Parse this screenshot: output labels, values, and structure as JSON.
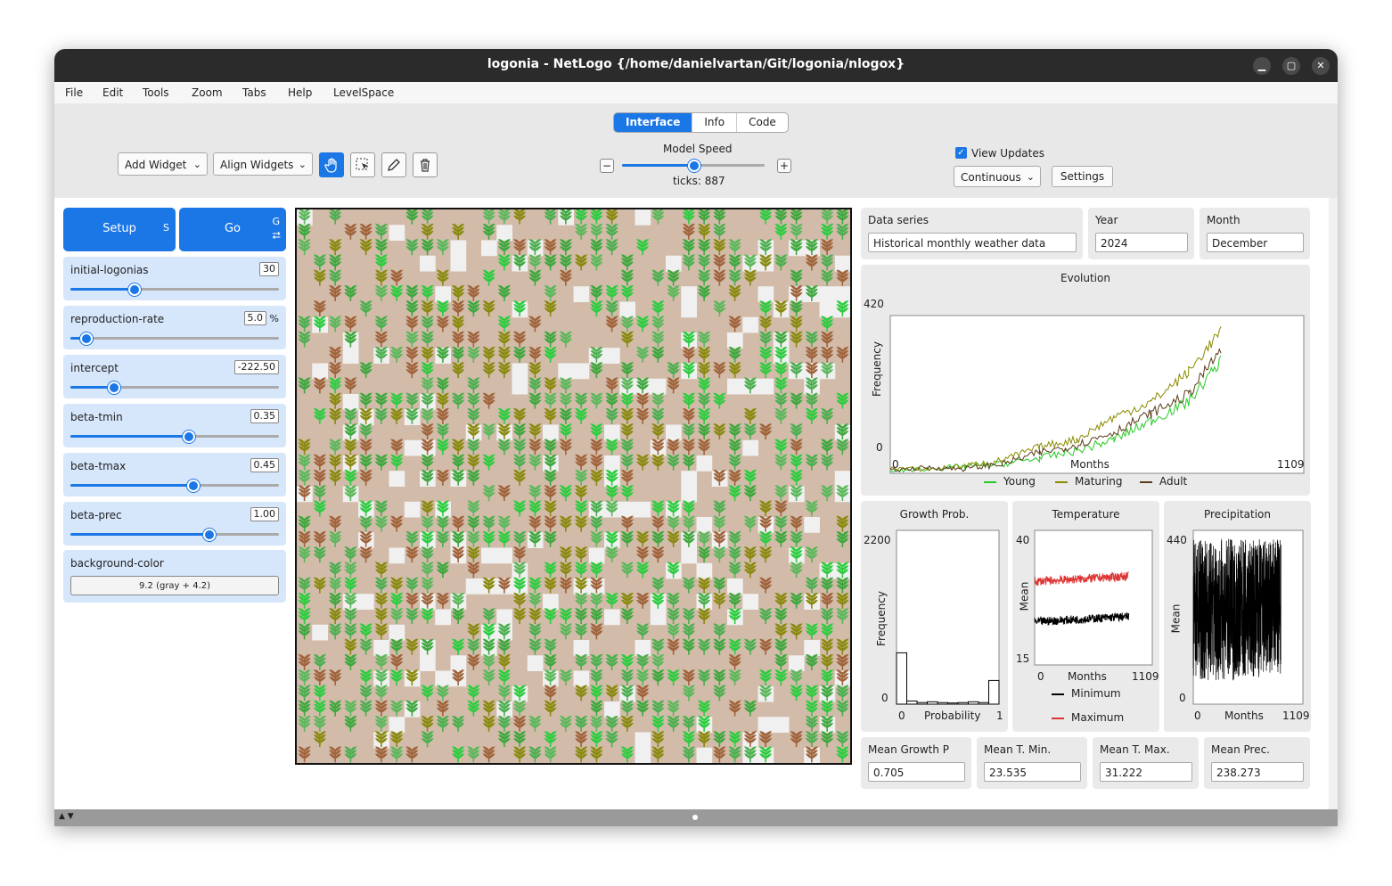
{
  "window": {
    "title": "logonia - NetLogo {/home/danielvartan/Git/logonia/nlogox}"
  },
  "menu": [
    "File",
    "Edit",
    "Tools",
    "Zoom",
    "Tabs",
    "Help",
    "LevelSpace"
  ],
  "tabs": [
    "Interface",
    "Info",
    "Code"
  ],
  "toolbar": {
    "add_widget": "Add Widget",
    "align_widgets": "Align Widgets",
    "model_speed": "Model Speed",
    "ticks": "ticks: 887",
    "minus": "−",
    "plus": "+",
    "speed_level": 0.5,
    "view_updates": "View Updates",
    "update_mode": "Continuous",
    "settings": "Settings"
  },
  "buttons": {
    "setup": "Setup",
    "setup_key": "S",
    "go": "Go",
    "go_key": "G"
  },
  "sliders": [
    {
      "name": "initial-logonias",
      "value": "30",
      "unit": "",
      "level": 0.3
    },
    {
      "name": "reproduction-rate",
      "value": "5.0",
      "unit": "%",
      "level": 0.07
    },
    {
      "name": "intercept",
      "value": "-222.50",
      "unit": "",
      "level": 0.2
    },
    {
      "name": "beta-tmin",
      "value": "0.35",
      "unit": "",
      "level": 0.56
    },
    {
      "name": "beta-tmax",
      "value": "0.45",
      "unit": "",
      "level": 0.58
    },
    {
      "name": "beta-prec",
      "value": "1.00",
      "unit": "",
      "level": 0.66
    }
  ],
  "chooser": {
    "name": "background-color",
    "value": "9.2 (gray + 4.2)"
  },
  "inputs": {
    "data_series_label": "Data series",
    "data_series_value": "Historical monthly weather data",
    "year_label": "Year",
    "year_value": "2024",
    "month_label": "Month",
    "month_value": "December"
  },
  "monitors": [
    {
      "label": "Mean Growth P",
      "value": "0.705"
    },
    {
      "label": "Mean T. Min.",
      "value": "23.535"
    },
    {
      "label": "Mean T. Max.",
      "value": "31.222"
    },
    {
      "label": "Mean Prec.",
      "value": "238.273"
    }
  ],
  "colors": {
    "accent": "#1b77e6",
    "young": "#22cc22",
    "maturing": "#8b8b00",
    "adult": "#5a3a1a",
    "minimum": "#000000",
    "maximum": "#dd3333"
  },
  "chart_data": [
    {
      "type": "line",
      "title": "Evolution",
      "xlabel": "Months",
      "ylabel": "Frequency",
      "xlim": [
        0,
        1109
      ],
      "ylim": [
        0,
        420
      ],
      "x": [
        0,
        100,
        200,
        300,
        400,
        500,
        600,
        700,
        800,
        887
      ],
      "series": [
        {
          "name": "Young",
          "values": [
            5,
            12,
            18,
            25,
            40,
            60,
            90,
            140,
            190,
            300
          ]
        },
        {
          "name": "Maturing",
          "values": [
            15,
            10,
            20,
            35,
            70,
            90,
            150,
            190,
            270,
            380
          ]
        },
        {
          "name": "Adult",
          "values": [
            8,
            15,
            12,
            25,
            55,
            75,
            110,
            160,
            210,
            330
          ]
        }
      ]
    },
    {
      "type": "bar",
      "title": "Growth Prob.",
      "xlabel": "Probability",
      "ylabel": "Frequency",
      "xlim": [
        0,
        1
      ],
      "ylim": [
        0,
        2200
      ],
      "categories": [
        "0.0",
        "0.1",
        "0.2",
        "0.3",
        "0.4",
        "0.5",
        "0.6",
        "0.7",
        "0.8",
        "0.9"
      ],
      "values": [
        650,
        40,
        20,
        30,
        20,
        15,
        20,
        30,
        20,
        300
      ]
    },
    {
      "type": "line",
      "title": "Temperature",
      "xlabel": "Months",
      "ylabel": "Mean",
      "xlim": [
        0,
        1109
      ],
      "ylim": [
        15,
        40
      ],
      "x": [
        0,
        887
      ],
      "series": [
        {
          "name": "Minimum",
          "values": [
            23.0,
            24.0
          ]
        },
        {
          "name": "Maximum",
          "values": [
            30.5,
            31.5
          ]
        }
      ]
    },
    {
      "type": "line",
      "title": "Precipitation",
      "xlabel": "Months",
      "ylabel": "Mean",
      "xlim": [
        0,
        1109
      ],
      "ylim": [
        0,
        440
      ],
      "x": [
        0,
        887
      ],
      "series": [
        {
          "name": "",
          "values": [
            240,
            240
          ]
        }
      ]
    }
  ],
  "chart_axis_labels": {
    "evolution": {
      "ymax": "420",
      "ymin": "0",
      "xmin": "0",
      "xmax": "1109"
    },
    "growth": {
      "ymax": "2200",
      "ymin": "0",
      "xmin": "0",
      "xmax": "1"
    },
    "temperature": {
      "ymax": "40",
      "ymin": "15",
      "xmin": "0",
      "xmax": "1109"
    },
    "precipitation": {
      "ymax": "440",
      "ymin": "0",
      "xmin": "0",
      "xmax": "1109"
    }
  }
}
